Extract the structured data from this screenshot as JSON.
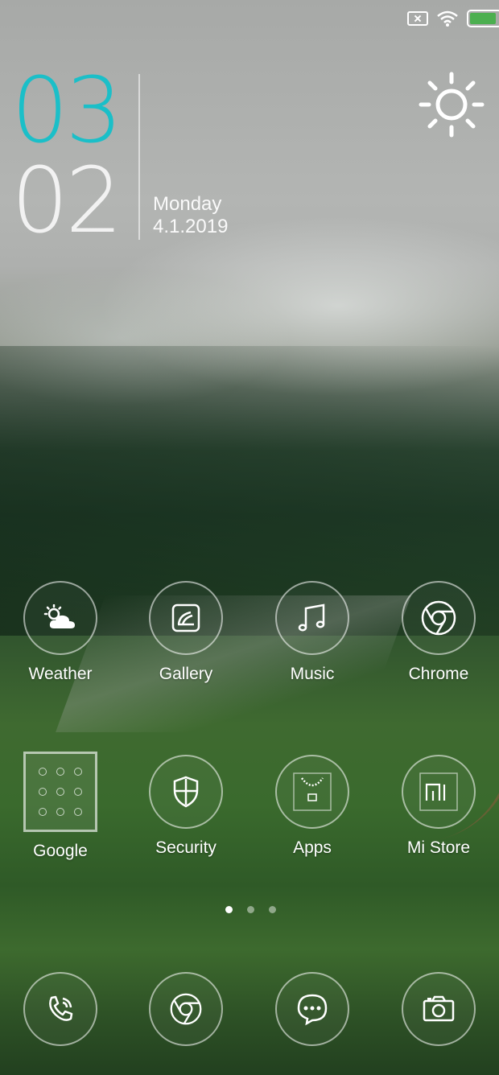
{
  "status_bar": {
    "icons": [
      "sim-card-none-icon",
      "wifi-icon",
      "battery-charging-icon"
    ],
    "battery_color": "#4caf50"
  },
  "clock": {
    "hour": "03",
    "minute": "02",
    "day": "Monday",
    "date": "4.1.2019",
    "hour_color": "#1bbfc8"
  },
  "weather_widget": {
    "icon": "sun-icon"
  },
  "apps": [
    {
      "label": "Weather",
      "icon": "weather-icon"
    },
    {
      "label": "Gallery",
      "icon": "gallery-icon"
    },
    {
      "label": "Music",
      "icon": "music-icon"
    },
    {
      "label": "Chrome",
      "icon": "chrome-icon"
    },
    {
      "label": "Google",
      "icon": "folder-icon"
    },
    {
      "label": "Security",
      "icon": "shield-icon"
    },
    {
      "label": "Apps",
      "icon": "apps-store-icon"
    },
    {
      "label": "Mi Store",
      "icon": "mi-store-icon"
    }
  ],
  "page_indicator": {
    "pages": 3,
    "current": 1
  },
  "dock": [
    {
      "icon": "phone-icon"
    },
    {
      "icon": "chrome-icon"
    },
    {
      "icon": "messages-icon"
    },
    {
      "icon": "camera-icon"
    }
  ]
}
